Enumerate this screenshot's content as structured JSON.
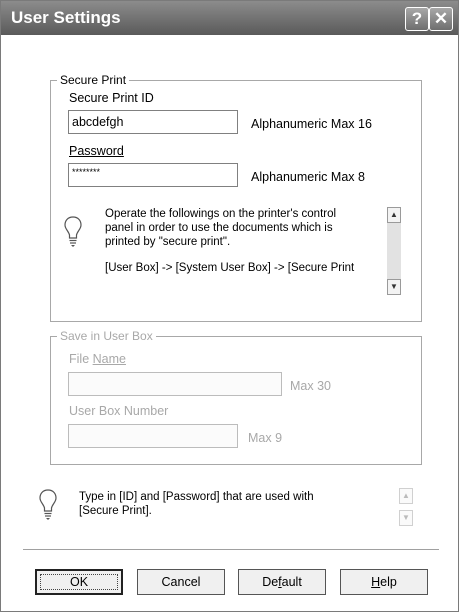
{
  "window": {
    "title": "User Settings",
    "help_btn": "?",
    "close_btn": "✕"
  },
  "secure_print": {
    "legend": "Secure Print",
    "id_label": "Secure Print ID",
    "id_value": "abcdefgh",
    "id_hint": "Alphanumeric Max 16",
    "password_label": "Password",
    "password_value": "********",
    "password_hint": "Alphanumeric Max 8",
    "info_line1": "Operate the followings on the printer's control",
    "info_line2": "panel in order to use the documents which is",
    "info_line3": "printed by \"secure print\".",
    "info_line4": "[User Box] -> [System User Box] -> [Secure Print"
  },
  "user_box": {
    "legend": "Save in User Box",
    "file_name_label": "File Name",
    "file_name_value": "",
    "file_name_hint": "Max 30",
    "box_number_label": "User Box Number",
    "box_number_value": "",
    "box_number_hint": "Max 9"
  },
  "hint": {
    "line1": "Type in [ID] and [Password] that are used with",
    "line2": "[Secure Print]."
  },
  "buttons": {
    "ok": "OK",
    "cancel": "Cancel",
    "default": "Default",
    "help": "Help"
  },
  "icons": {
    "info": "lightbulb-icon",
    "scroll_up": "arrow-up-icon",
    "scroll_down": "arrow-down-icon"
  }
}
